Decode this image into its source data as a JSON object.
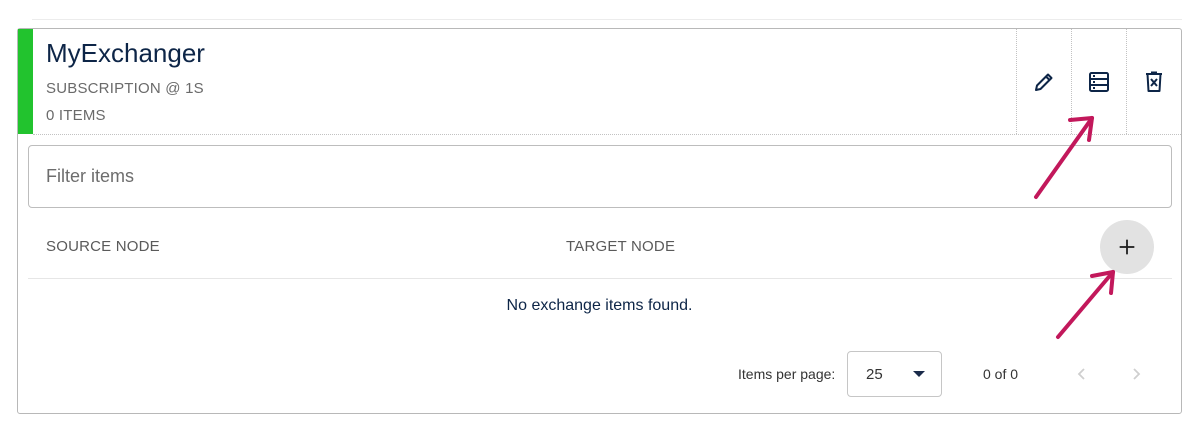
{
  "exchanger": {
    "title": "MyExchanger",
    "subtitle": "SUBSCRIPTION @ 1S",
    "item_count": "0 ITEMS",
    "accent_color": "#22c32e"
  },
  "actions": [
    {
      "icon": "pencil-icon"
    },
    {
      "icon": "list-icon"
    },
    {
      "icon": "delete-icon"
    }
  ],
  "filter": {
    "placeholder": "Filter items",
    "value": ""
  },
  "table": {
    "columns": [
      "SOURCE NODE",
      "TARGET NODE"
    ],
    "add_icon": "plus-icon",
    "empty_message": "No exchange items found."
  },
  "pagination": {
    "items_per_page_label": "Items per page:",
    "items_per_page_value": "25",
    "range_label": "0 of 0"
  },
  "annotation_color": "#c2185b"
}
